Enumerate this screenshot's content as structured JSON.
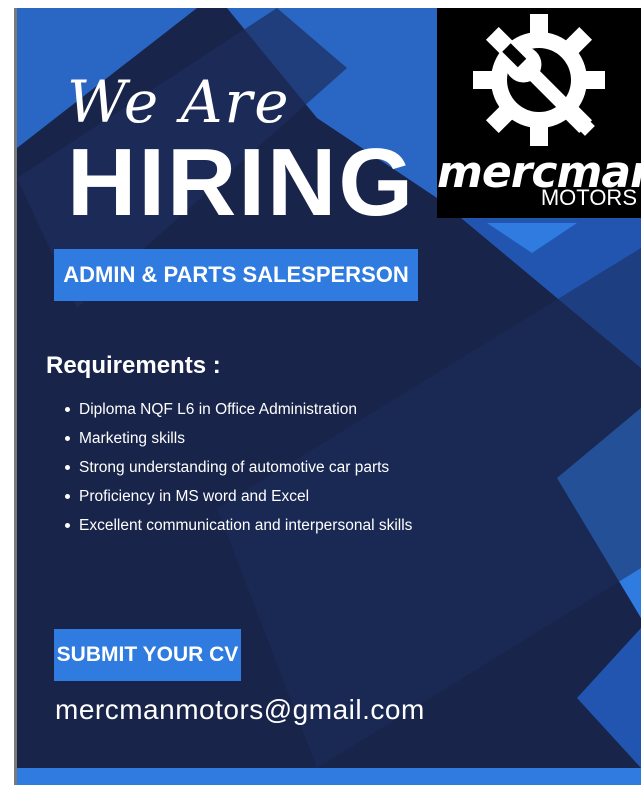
{
  "poster": {
    "script_title": "We Are",
    "big_title": "HIRING",
    "position": "ADMIN & PARTS SALESPERSON",
    "requirements_heading": "Requirements :",
    "requirements": [
      "Diploma NQF L6 in Office Administration",
      "Marketing skills",
      "Strong understanding of automotive car parts",
      "Proficiency in MS word and Excel",
      "Excellent communication and interpersonal skills"
    ],
    "cta": "SUBMIT YOUR CV",
    "email": "mercmanmotors@gmail.com"
  },
  "logo": {
    "wordmark": "mercman",
    "sub": "MOTORS",
    "icon": "gear-wrench-icon"
  },
  "colors": {
    "background": "#18244a",
    "accent": "#2f7be0",
    "text": "#ffffff"
  }
}
